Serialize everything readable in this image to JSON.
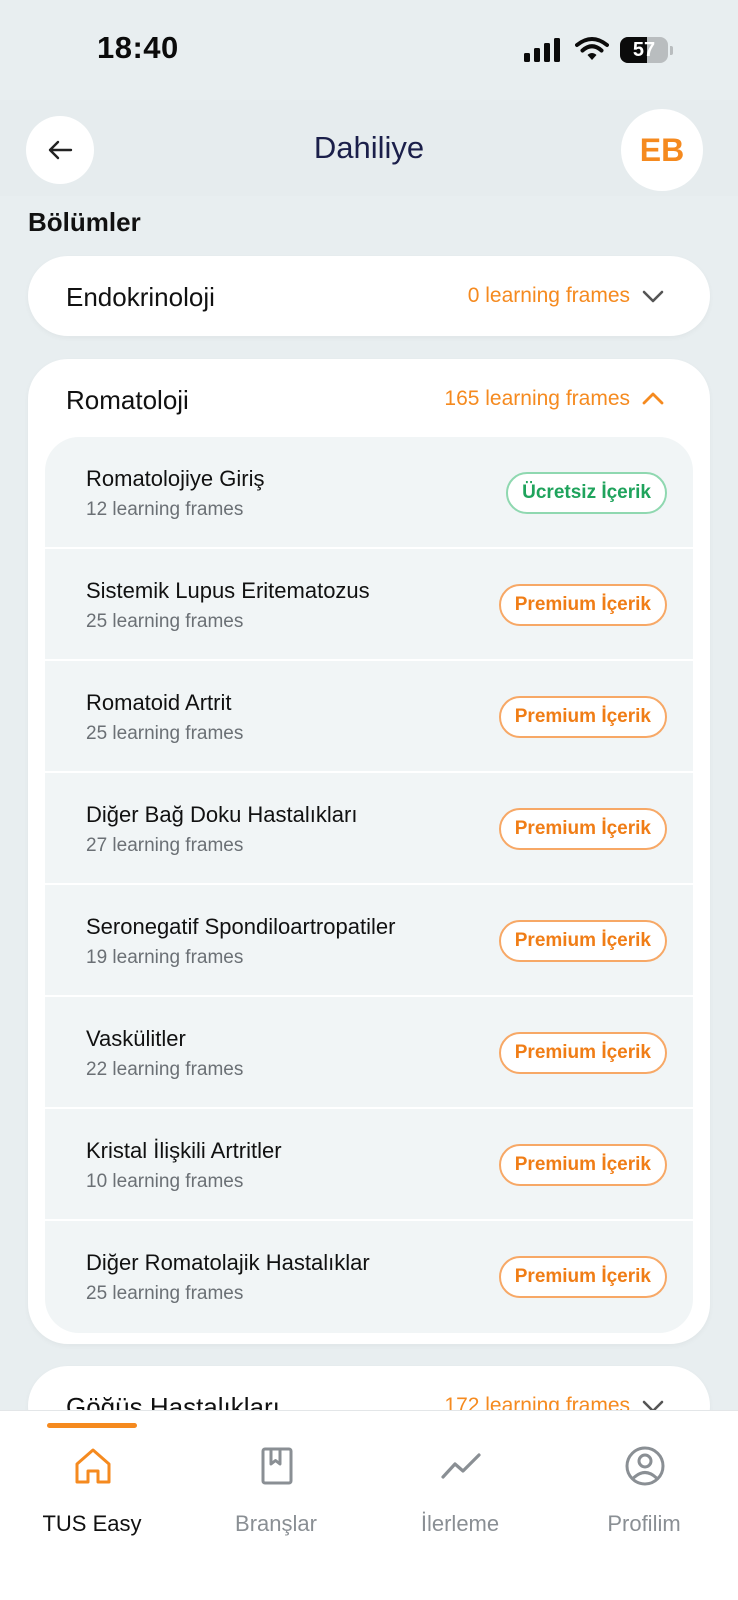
{
  "status_bar": {
    "time": "18:40",
    "battery": "57",
    "battery_level": 0.57
  },
  "header": {
    "title": "Dahiliye",
    "avatar_initials": "EB",
    "back_icon": "arrow-left-icon"
  },
  "section_heading": "Bölümler",
  "cards": [
    {
      "title": "Endokrinoloji",
      "count": "0 learning frames",
      "expanded": false
    },
    {
      "title": "Romatoloji",
      "count": "165 learning frames",
      "expanded": true,
      "items": [
        {
          "title": "Romatolojiye Giriş",
          "count": "12 learning frames",
          "badge": "Ücretsiz İçerik",
          "type": "free"
        },
        {
          "title": "Sistemik Lupus Eritematozus",
          "count": "25 learning frames",
          "badge": "Premium İçerik",
          "type": "premium"
        },
        {
          "title": "Romatoid Artrit",
          "count": "25 learning frames",
          "badge": "Premium İçerik",
          "type": "premium"
        },
        {
          "title": "Diğer Bağ Doku Hastalıkları",
          "count": "27 learning frames",
          "badge": "Premium İçerik",
          "type": "premium"
        },
        {
          "title": "Seronegatif Spondiloartropatiler",
          "count": "19 learning frames",
          "badge": "Premium İçerik",
          "type": "premium"
        },
        {
          "title": "Vaskülitler",
          "count": "22 learning frames",
          "badge": "Premium İçerik",
          "type": "premium"
        },
        {
          "title": "Kristal İlişkili Artritler",
          "count": "10 learning frames",
          "badge": "Premium İçerik",
          "type": "premium"
        },
        {
          "title": "Diğer Romatolajik Hastalıklar",
          "count": "25 learning frames",
          "badge": "Premium İçerik",
          "type": "premium"
        }
      ]
    },
    {
      "title": "Göğüs Hastalıkları",
      "count": "172 learning frames",
      "expanded": false
    }
  ],
  "bottom_nav": [
    {
      "label": "TUS Easy",
      "icon": "home-icon",
      "active": true
    },
    {
      "label": "Branşlar",
      "icon": "book-icon",
      "active": false
    },
    {
      "label": "İlerleme",
      "icon": "trend-line-icon",
      "active": false
    },
    {
      "label": "Profilim",
      "icon": "user-circle-icon",
      "active": false
    }
  ],
  "colors": {
    "accent": "#f58a1f",
    "free_green": "#1fa35c",
    "title_navy": "#1b1f4a"
  }
}
